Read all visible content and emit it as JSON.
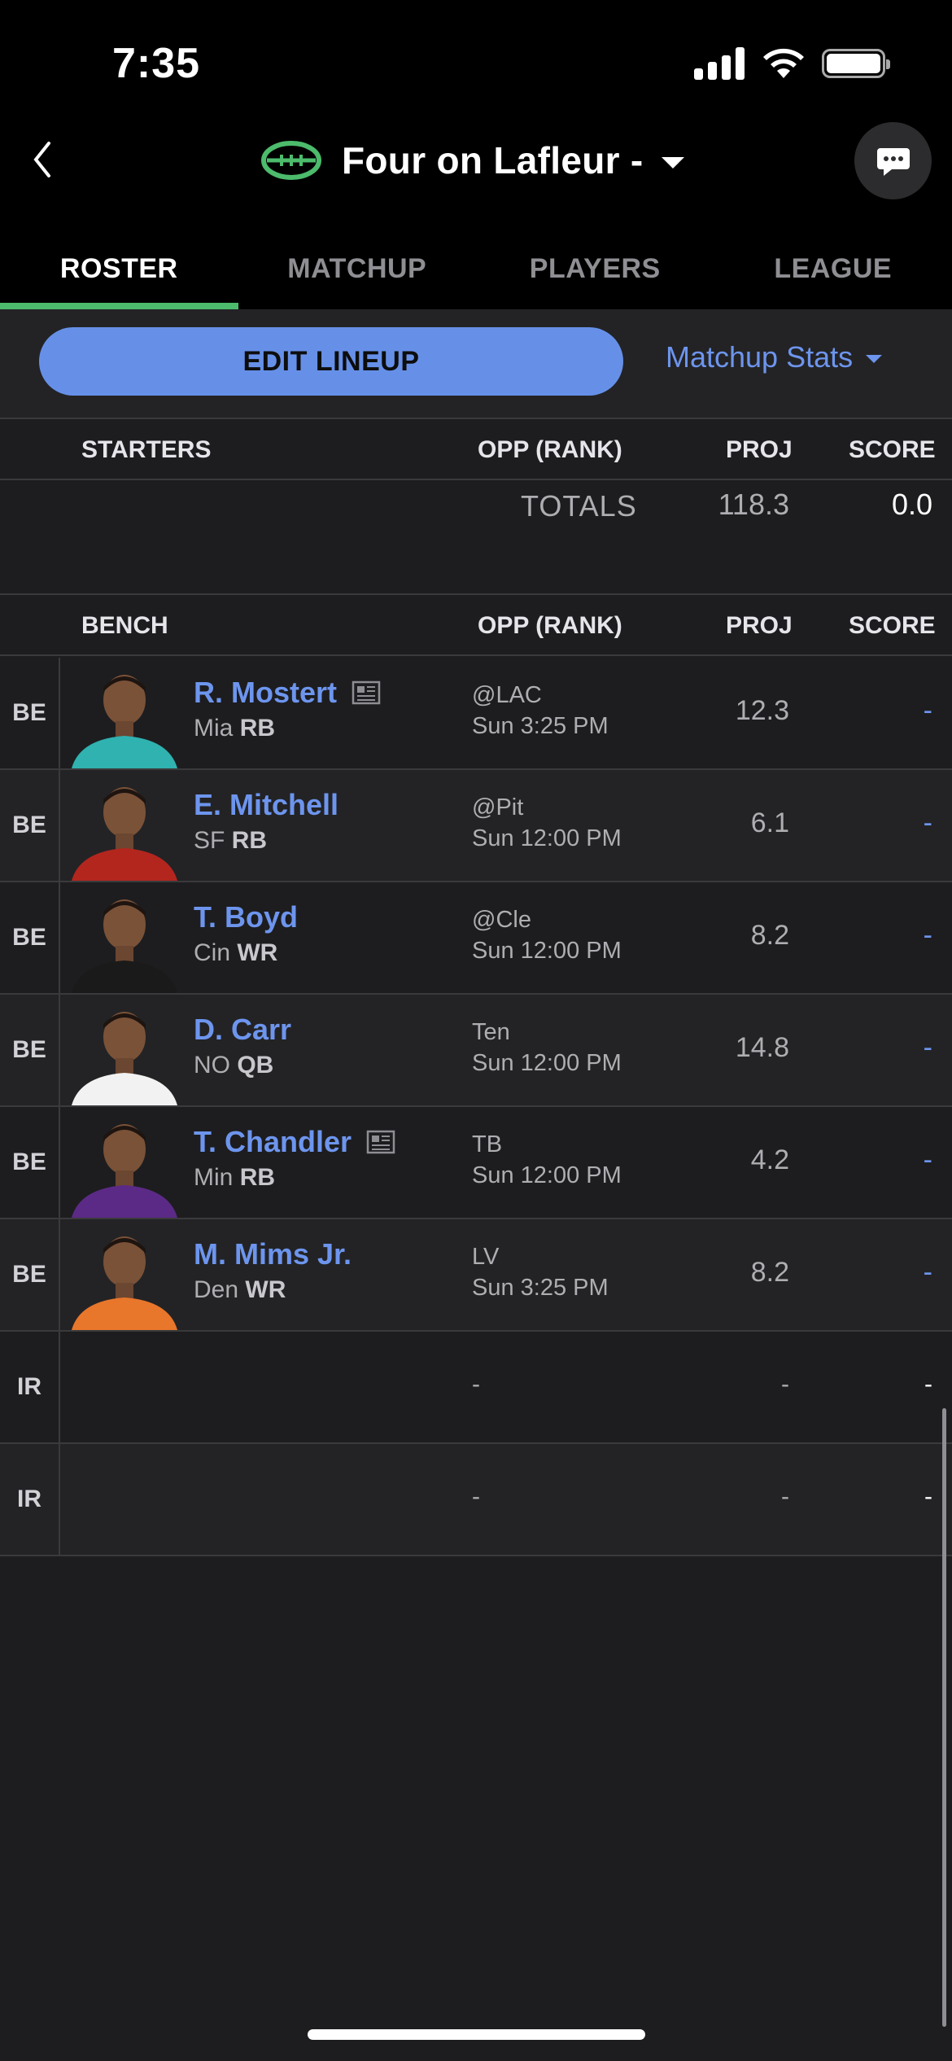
{
  "status": {
    "time": "7:35"
  },
  "header": {
    "team_name": "Four on Lafleur -",
    "icons": {
      "back": "chevron-left-icon",
      "logo": "football-icon",
      "caret": "caret-down-icon",
      "chat": "chat-bubble-icon"
    }
  },
  "tabs": [
    {
      "label": "ROSTER",
      "active": true
    },
    {
      "label": "MATCHUP",
      "active": false
    },
    {
      "label": "PLAYERS",
      "active": false
    },
    {
      "label": "LEAGUE",
      "active": false
    }
  ],
  "actions": {
    "edit_lineup": "EDIT LINEUP",
    "matchup_stats": "Matchup Stats"
  },
  "starters": {
    "headers": {
      "label": "STARTERS",
      "opp": "OPP (RANK)",
      "proj": "PROJ",
      "score": "SCORE"
    },
    "totals": {
      "label": "TOTALS",
      "proj": "118.3",
      "score": "0.0"
    }
  },
  "bench": {
    "headers": {
      "label": "BENCH",
      "opp": "OPP (RANK)",
      "proj": "PROJ",
      "score": "SCORE"
    },
    "rows": [
      {
        "slot": "BE",
        "name": "R. Mostert",
        "team": "Mia",
        "pos": "RB",
        "opp": "@LAC",
        "time": "Sun 3:25 PM",
        "proj": "12.3",
        "score": "-",
        "news": true,
        "jersey": "#2fb2b0"
      },
      {
        "slot": "BE",
        "name": "E. Mitchell",
        "team": "SF",
        "pos": "RB",
        "opp": "@Pit",
        "time": "Sun 12:00 PM",
        "proj": "6.1",
        "score": "-",
        "news": false,
        "jersey": "#b3261e"
      },
      {
        "slot": "BE",
        "name": "T. Boyd",
        "team": "Cin",
        "pos": "WR",
        "opp": "@Cle",
        "time": "Sun 12:00 PM",
        "proj": "8.2",
        "score": "-",
        "news": false,
        "jersey": "#1a1a1a"
      },
      {
        "slot": "BE",
        "name": "D. Carr",
        "team": "NO",
        "pos": "QB",
        "opp": "Ten",
        "time": "Sun 12:00 PM",
        "proj": "14.8",
        "score": "-",
        "news": false,
        "jersey": "#f2f2f2"
      },
      {
        "slot": "BE",
        "name": "T. Chandler",
        "team": "Min",
        "pos": "RB",
        "opp": "TB",
        "time": "Sun 12:00 PM",
        "proj": "4.2",
        "score": "-",
        "news": true,
        "jersey": "#5b2a86"
      },
      {
        "slot": "BE",
        "name": "M. Mims Jr.",
        "team": "Den",
        "pos": "WR",
        "opp": "LV",
        "time": "Sun 3:25 PM",
        "proj": "8.2",
        "score": "-",
        "news": false,
        "jersey": "#e8762b"
      }
    ],
    "ir_rows": [
      {
        "slot": "IR",
        "opp": "-",
        "proj": "-",
        "score": "-"
      },
      {
        "slot": "IR",
        "opp": "-",
        "proj": "-",
        "score": "-"
      }
    ]
  }
}
